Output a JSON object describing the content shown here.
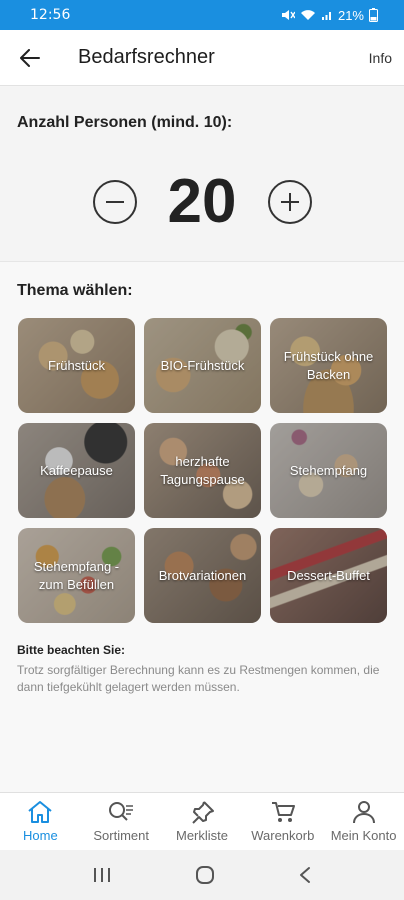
{
  "status": {
    "time": "12:56",
    "battery": "21%"
  },
  "header": {
    "title": "Bedarfsrechner",
    "info_label": "Info"
  },
  "persons": {
    "label": "Anzahl Personen (mind. 10):",
    "count": "20"
  },
  "themes": {
    "label": "Thema wählen:",
    "items": [
      {
        "label": "Frühstück"
      },
      {
        "label": "BIO-Frühstück"
      },
      {
        "label": "Frühstück ohne Backen"
      },
      {
        "label": "Kaffeepause"
      },
      {
        "label": "herzhafte Tagungspause"
      },
      {
        "label": "Stehempfang"
      },
      {
        "label": "Stehempfang - zum Befüllen"
      },
      {
        "label": "Brotvariationen"
      },
      {
        "label": "Dessert-Buffet"
      }
    ]
  },
  "note": {
    "title": "Bitte beachten Sie:",
    "text": "Trotz sorgfältiger Berechnung kann es zu Restmengen kommen, die dann tiefgekühlt gelagert werden müssen."
  },
  "nav": {
    "items": [
      {
        "label": "Home",
        "icon": "home-icon",
        "active": true
      },
      {
        "label": "Sortiment",
        "icon": "search-list-icon"
      },
      {
        "label": "Merkliste",
        "icon": "pin-icon"
      },
      {
        "label": "Warenkorb",
        "icon": "cart-icon"
      },
      {
        "label": "Mein Konto",
        "icon": "person-icon"
      }
    ]
  },
  "colors": {
    "accent": "#1a8fe0",
    "status_bar": "#1a8fe0"
  }
}
